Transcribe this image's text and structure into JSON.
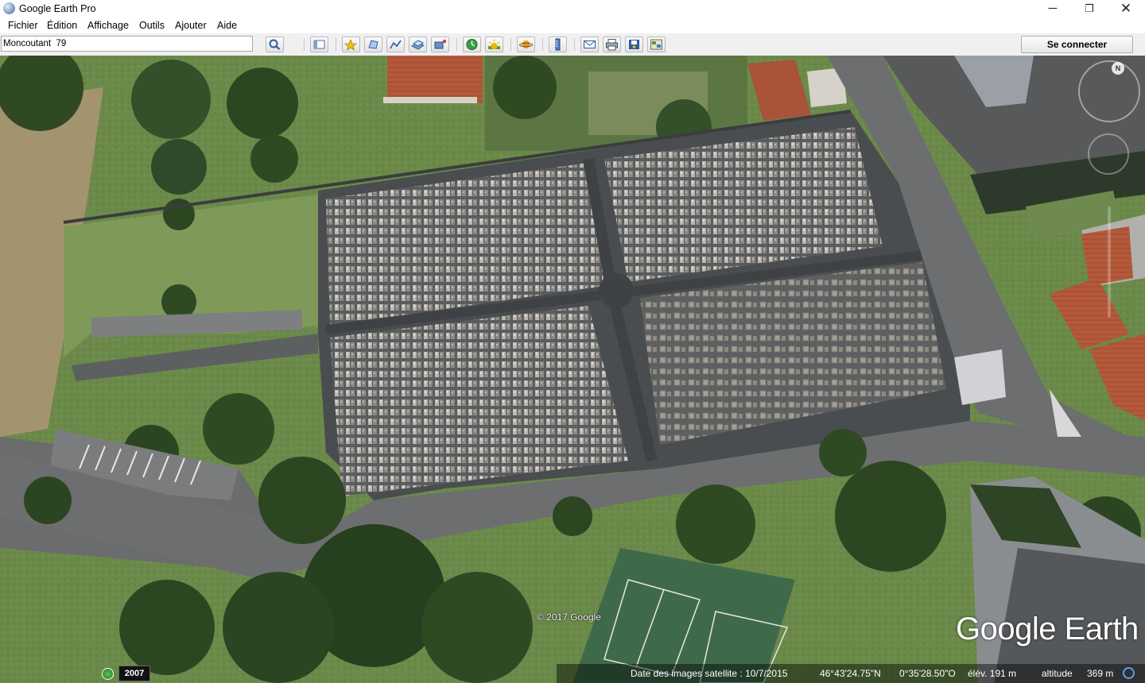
{
  "window": {
    "title": "Google Earth Pro",
    "controls": {
      "minimize": "─",
      "maximize": "❐",
      "close": "✕"
    }
  },
  "menu": [
    {
      "label": "Fichier"
    },
    {
      "label": "Édition"
    },
    {
      "label": "Affichage"
    },
    {
      "label": "Outils"
    },
    {
      "label": "Ajouter"
    },
    {
      "label": "Aide"
    }
  ],
  "toolbar": {
    "search_value": "Moncoutant  79",
    "buttons": [
      "search-icon",
      "sidebar-icon",
      "placemark-icon",
      "polygon-icon",
      "path-icon",
      "image-overlay-icon",
      "record-tour-icon",
      "historical-imagery-icon",
      "sunlight-icon",
      "planets-icon",
      "ruler-icon",
      "email-icon",
      "print-icon",
      "save-image-icon",
      "view-in-maps-icon"
    ],
    "signin_label": "Se connecter"
  },
  "map": {
    "copyright": "© 2017 Google",
    "brand": "Google Earth",
    "compass_letter": "N"
  },
  "status": {
    "history_year": "2007",
    "imagery_date": "Date des images satellite : 10/7/2015",
    "latitude": "46°43'24.75\"N",
    "longitude": "0°35'28.50\"O",
    "elevation": "élév.  191 m",
    "altitude_label": "altitude",
    "altitude_value": "369 m"
  },
  "colors": {
    "grass": "#6b8a4a",
    "trees": "#2f4a23",
    "asphalt": "#4a4d4f",
    "road": "#6c6e70",
    "roof_tile": "#b5593a"
  }
}
